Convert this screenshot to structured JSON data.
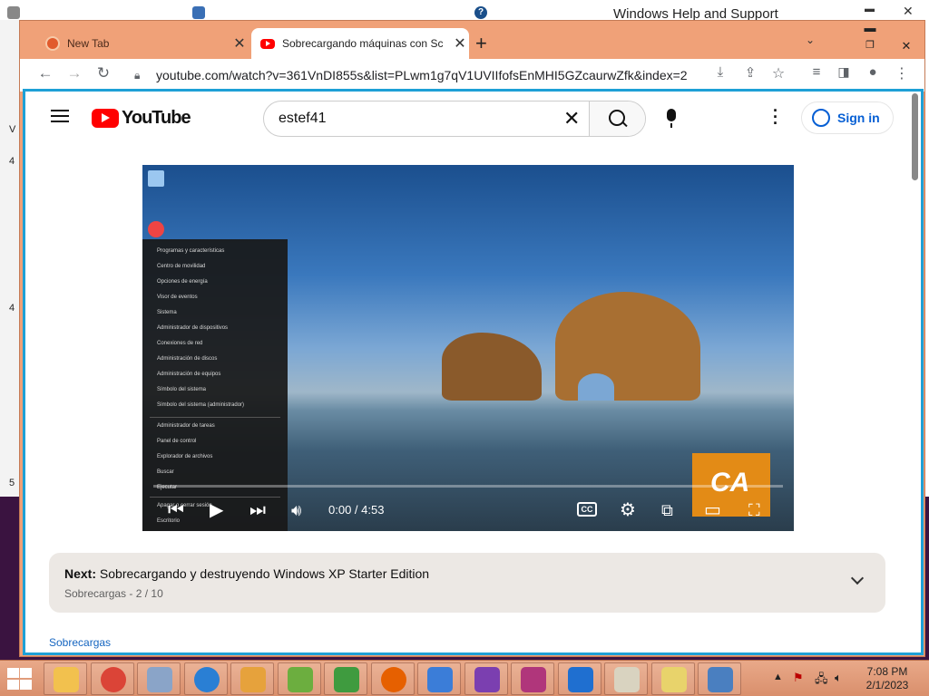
{
  "background_window": {
    "title": "Windows Help and Support",
    "left_strip_marks": [
      "V",
      "4",
      "4",
      "5"
    ]
  },
  "browser": {
    "tabs": [
      {
        "title": "New Tab",
        "active": false
      },
      {
        "title": "Sobrecargando máquinas con Sc",
        "active": true
      }
    ],
    "new_tab_glyph": "+",
    "url": "youtube.com/watch?v=361VnDI855s&list=PLwm1g7qV1UVIIfofsEnMHI5GZcaurwZfk&index=2"
  },
  "youtube": {
    "logo_text": "YouTube",
    "search_value": "estef41",
    "sign_in_label": "Sign in",
    "player": {
      "time": "0:00 / 4:53",
      "cc_label": "CC",
      "overlay_logo": "CA",
      "start_menu_items": [
        "Programas y características",
        "Centro de movilidad",
        "Opciones de energía",
        "Visor de eventos",
        "Sistema",
        "Administrador de dispositivos",
        "Conexiones de red",
        "Administración de discos",
        "Administración de equipos",
        "Símbolo del sistema",
        "Símbolo del sistema (administrador)",
        "Administrador de tareas",
        "Panel de control",
        "Explorador de archivos",
        "Buscar",
        "Ejecutar",
        "Apagar o cerrar sesión",
        "Escritorio"
      ]
    },
    "next": {
      "label": "Next:",
      "title": "Sobrecargando y destruyendo Windows XP Starter Edition",
      "playlist": "Sobrecargas",
      "position": "2 / 10"
    },
    "channel_link": "Sobrecargas"
  },
  "taskbar": {
    "apps": [
      {
        "name": "file-explorer",
        "color": "#f2c14e"
      },
      {
        "name": "chrome",
        "color": "#db4437"
      },
      {
        "name": "system-monitor",
        "color": "#8aa4c8"
      },
      {
        "name": "internet-explorer",
        "color": "#2a7fd4"
      },
      {
        "name": "paint",
        "color": "#e6a23c"
      },
      {
        "name": "charts-app",
        "color": "#6cae3f"
      },
      {
        "name": "frog-app",
        "color": "#3f9b3f"
      },
      {
        "name": "firefox",
        "color": "#e66000"
      },
      {
        "name": "control-panel",
        "color": "#3b7dd8"
      },
      {
        "name": "mask-app",
        "color": "#7b3fb0"
      },
      {
        "name": "camera-app",
        "color": "#b0367b"
      },
      {
        "name": "mail-app",
        "color": "#1f6fd0"
      },
      {
        "name": "calculator",
        "color": "#d9d3c0"
      },
      {
        "name": "chat-app",
        "color": "#e8d36b"
      },
      {
        "name": "keyboard-app",
        "color": "#4a7fc0"
      }
    ],
    "time": "7:08 PM",
    "date": "2/1/2023"
  }
}
